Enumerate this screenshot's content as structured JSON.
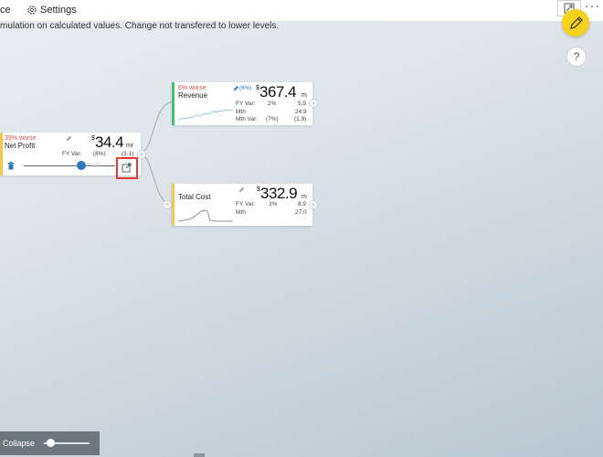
{
  "topbar": {
    "left_fragment": "ce",
    "settings_label": "Settings"
  },
  "info_text": "mulation on calculated values. Change not transfered to lower levels.",
  "net_profit": {
    "worse": "39% worse",
    "name": "Net Profit",
    "currency": "$",
    "value": "34.4",
    "unit": "mr",
    "fy_var_label": "FY Var:",
    "fy_var_pct": "(8%)",
    "fy_var_val": "(3.1)",
    "slider_ghost": "Net Profi",
    "slider_fraction": 0.63
  },
  "revenue": {
    "worse": "6% worse",
    "edit_pct": "(6%)",
    "name": "Revenue",
    "currency": "$",
    "value": "367.4",
    "unit": "m",
    "fy_var_label": "FY Var:",
    "fy_var_pct": "2%",
    "fy_var_val": "5.9",
    "mth_label": "Mth",
    "mth_val": "24.9",
    "mth_var_label": "Mth Var:",
    "mth_var_pct": "(7%)",
    "mth_var_val": "(1.9)"
  },
  "total_cost": {
    "name": "Total Cost",
    "currency": "$",
    "value": "332.9",
    "unit": "m",
    "fy_var_label": "FY Var:",
    "fy_var_pct": "3%",
    "fy_var_val": "8.9",
    "mth_label": "Mth",
    "mth_val": "27.0"
  },
  "collapse_label": "Collapse",
  "collapse_slider_fraction": 0.05,
  "help_label": "?",
  "more_label": "···",
  "colors": {
    "revenue_bar": "#3ec46d",
    "net_profit_bar": "#f2c94c",
    "cost_bar": "#f2c94c",
    "worse_text": "#e0524a",
    "slider_thumb": "#2e7ab8",
    "highlight_box": "#e53935",
    "pencil_fab": "#f5d21c"
  }
}
